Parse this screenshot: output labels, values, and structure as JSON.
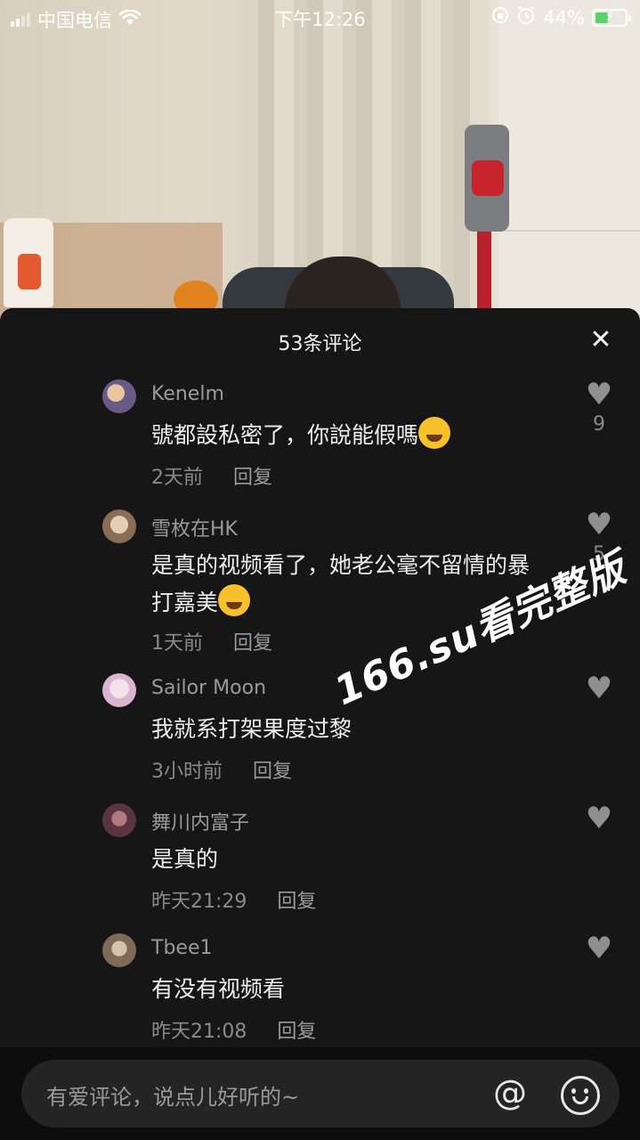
{
  "status_bar": {
    "carrier": "中国电信",
    "time": "下午12:26",
    "battery_percent": "44%",
    "battery_level": 0.44
  },
  "panel": {
    "title": "53条评论",
    "close_icon": "close-icon"
  },
  "comments": [
    {
      "username": "Kenelm",
      "text": "號都設私密了，你說能假嗎",
      "emoji": "rolling-laughing-emoji",
      "time": "2天前",
      "reply_label": "回复",
      "likes": "9",
      "avatar_color": "#6a5a88"
    },
    {
      "username": "雪枚在HK",
      "text": "是真的视频看了，她老公毫不留情的暴打嘉美",
      "emoji": "pleading-face-emoji",
      "time": "1天前",
      "reply_label": "回复",
      "likes": "5",
      "avatar_color": "#8a6d55"
    },
    {
      "username": "Sailor Moon",
      "text": "我就系打架果度过黎",
      "time": "3小时前",
      "reply_label": "回复",
      "likes": "",
      "avatar_color": "#d9b5cf"
    },
    {
      "username": "舞川内富子",
      "text": "是真的",
      "time": "昨天21:29",
      "reply_label": "回复",
      "likes": "",
      "avatar_color": "#5a3440"
    },
    {
      "username": "Tbee1",
      "text": "有没有视频看",
      "time": "昨天21:08",
      "reply_label": "回复",
      "likes": "",
      "avatar_color": "#7d6a58"
    }
  ],
  "watermark": "166.su看完整版",
  "input": {
    "placeholder": "有爱评论，说点儿好听的~",
    "at_label": "@"
  },
  "colors": {
    "panel_bg": "#161616",
    "input_bg": "#242424",
    "battery_green": "#5ad16a"
  }
}
